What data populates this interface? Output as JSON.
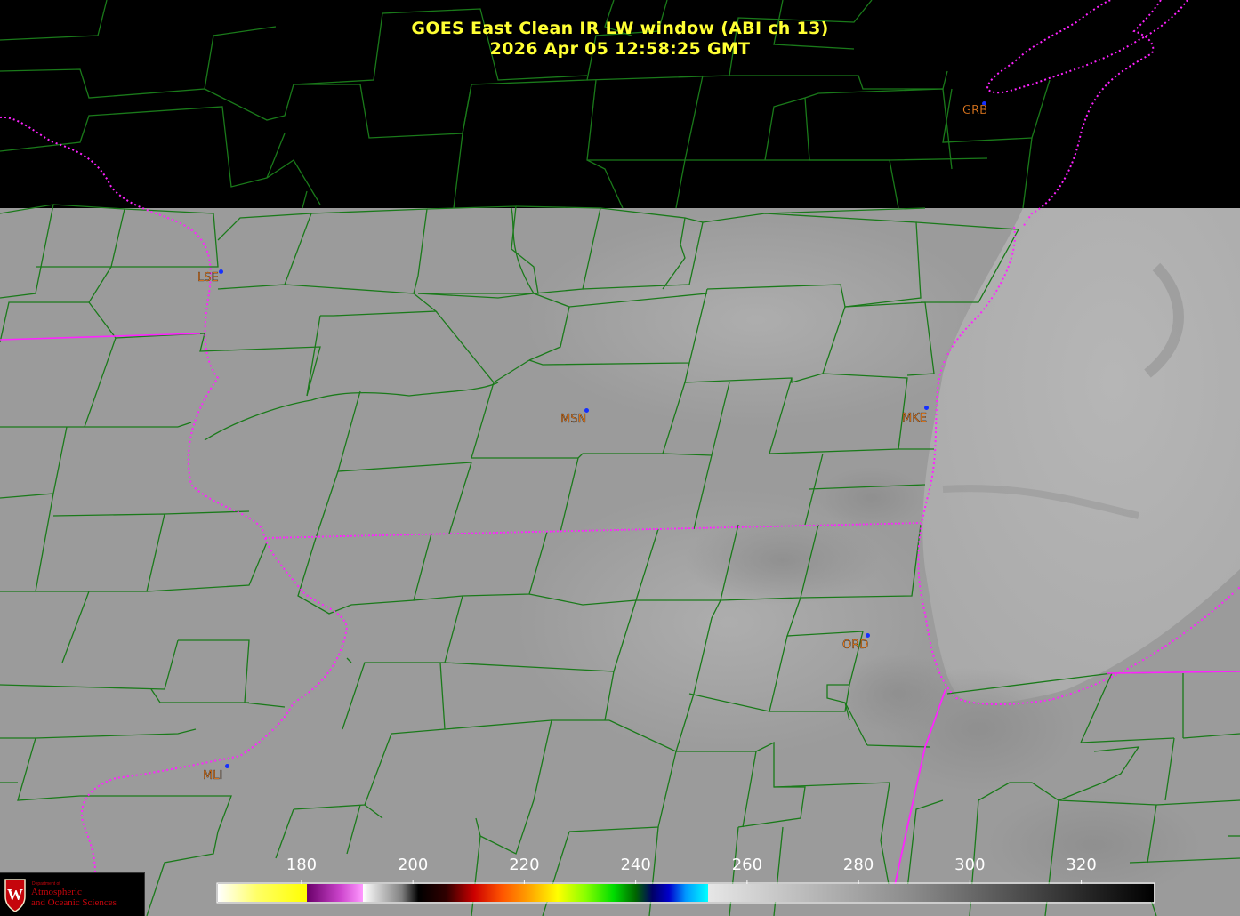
{
  "product": {
    "title_line1": "GOES East Clean IR LW window (ABI ch 13)",
    "title_line2": "2026 Apr 05  12:58:25 GMT"
  },
  "cities": [
    {
      "code": "GRB",
      "name": "green-bay"
    },
    {
      "code": "LSE",
      "name": "la-crosse"
    },
    {
      "code": "MSN",
      "name": "madison"
    },
    {
      "code": "MKE",
      "name": "milwaukee"
    },
    {
      "code": "ORD",
      "name": "chicago-ohare"
    },
    {
      "code": "MLI",
      "name": "moline"
    }
  ],
  "colorbar": {
    "ticks": [
      "180",
      "200",
      "220",
      "240",
      "260",
      "280",
      "300",
      "320"
    ],
    "range_min": 165,
    "range_max": 333
  },
  "logo": {
    "dept": "Department of",
    "line1": "Atmospheric",
    "line2": "and Oceanic Sciences",
    "seal_letter": "W"
  },
  "colors": {
    "background_no_data": "#000000",
    "ir_gray_mid": "#9c9c9c",
    "county_lines": "#1a7a1a",
    "state_borders": "#ff22ff",
    "title_text": "#ffff33",
    "city_label": "#f08020",
    "city_dot": "#1530ff",
    "logo_red": "#c5050c"
  }
}
